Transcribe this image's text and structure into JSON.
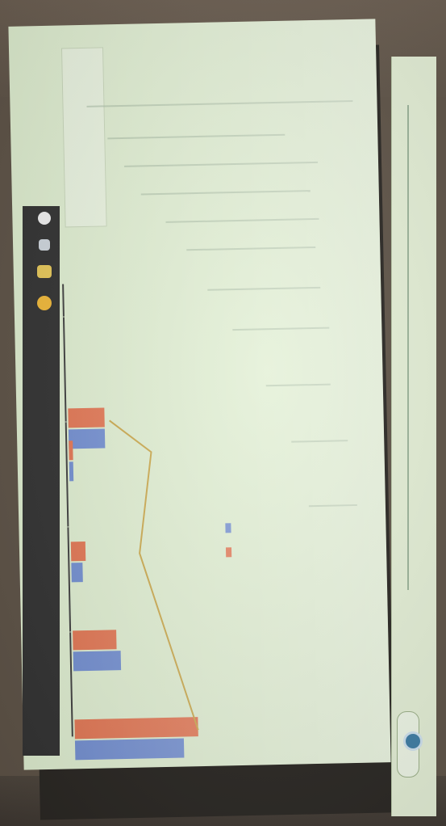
{
  "colors": {
    "wall": "#5e5347",
    "screen": "#dfeed0",
    "series_blue": "#6f8cd0",
    "series_orange": "#e2734f",
    "trend_line": "#c9a545"
  },
  "chart_data": {
    "type": "bar",
    "categories": [
      "",
      "",
      "",
      "",
      ""
    ],
    "series": [
      {
        "values": [
          30,
          13,
          3,
          1,
          10
        ]
      },
      {
        "values": [
          34,
          12,
          4,
          1,
          10
        ]
      }
    ],
    "line": {
      "values": [
        18,
        14,
        10,
        12,
        6
      ]
    },
    "title": "",
    "xlabel": "",
    "ylabel": "",
    "ylim": [
      0,
      40
    ],
    "grid": true,
    "legend": "bottom"
  },
  "icons": [
    "photo-icon",
    "settings-icon",
    "folder-icon",
    "chrome-icon",
    "refresh-icon"
  ]
}
